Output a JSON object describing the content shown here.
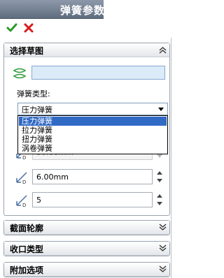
{
  "window": {
    "title": "弹簧参数"
  },
  "actions": {
    "ok": "ok",
    "cancel": "cancel"
  },
  "sections": {
    "sketch": {
      "title": "选择草图"
    },
    "profile": {
      "title": "截面轮廓"
    },
    "closure": {
      "title": "收口类型"
    },
    "extra": {
      "title": "附加选项"
    }
  },
  "spring_type": {
    "label": "弹簧类型:",
    "selected": "压力弹簧",
    "options": [
      "压力弹簧",
      "拉力弹簧",
      "扭力弹簧",
      "涡卷弹簧"
    ]
  },
  "params": [
    {
      "value": "30.00mm",
      "disabled": true
    },
    {
      "value": "6.00mm",
      "disabled": false
    },
    {
      "value": "5",
      "disabled": false
    }
  ],
  "colors": {
    "title_bar": "#6d7a8c",
    "ok_green": "#2a9a2a",
    "cancel_red": "#d41c1c",
    "selection_blue": "#316ac5",
    "sketch_box": "#dcebf8"
  },
  "icons": {
    "ok": "check-icon",
    "cancel": "x-icon",
    "sketch": "sketch-selection-icon",
    "dimension": "dimension-icon",
    "collapse": "chevron-up-icon",
    "expand": "chevron-down-icon"
  }
}
